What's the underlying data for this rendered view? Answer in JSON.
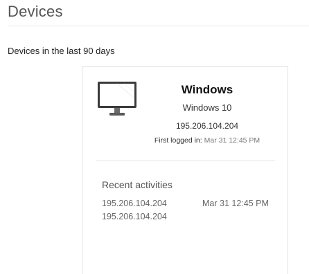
{
  "page": {
    "title": "Devices",
    "subtitle": "Devices in the last 90 days"
  },
  "device": {
    "icon": "monitor-icon",
    "name": "Windows",
    "os": "Windows 10",
    "ip": "195.206.104.204",
    "first_logged_label": "First logged in:",
    "first_logged_value": "Mar 31 12:45 PM"
  },
  "recent": {
    "title": "Recent activities",
    "items": [
      {
        "ip": "195.206.104.204",
        "time": "Mar 31 12:45 PM"
      },
      {
        "ip": "195.206.104.204",
        "time": ""
      }
    ]
  }
}
